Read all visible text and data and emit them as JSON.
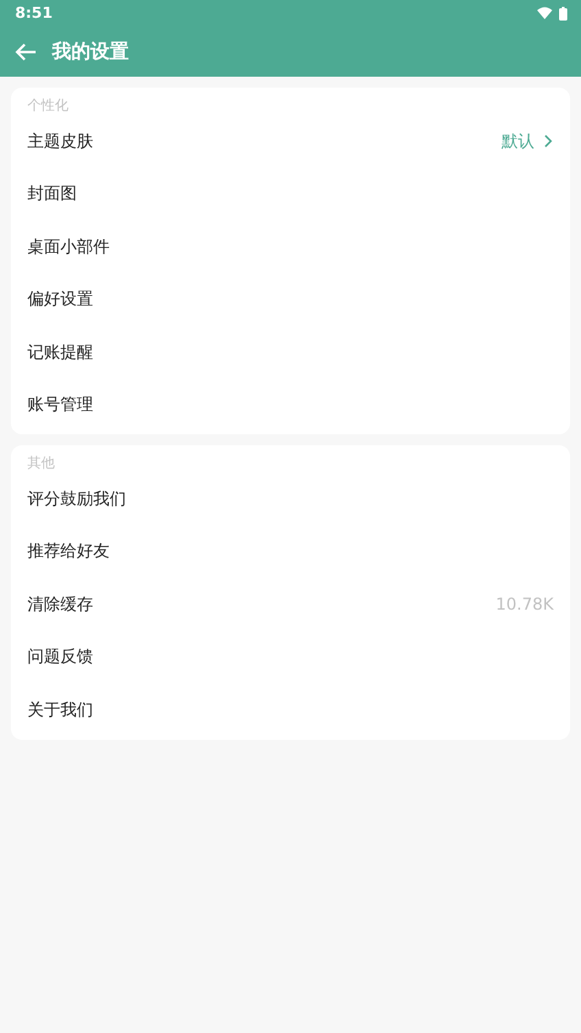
{
  "status_bar": {
    "time": "8:51"
  },
  "app_bar": {
    "title": "我的设置"
  },
  "sections": [
    {
      "header": "个性化",
      "items": [
        {
          "label": "主题皮肤",
          "kind": "link",
          "value": "默认"
        },
        {
          "label": "封面图",
          "kind": "plain"
        },
        {
          "label": "桌面小部件",
          "kind": "plain"
        },
        {
          "label": "偏好设置",
          "kind": "plain"
        },
        {
          "label": "记账提醒",
          "kind": "plain"
        },
        {
          "label": "账号管理",
          "kind": "plain"
        }
      ]
    },
    {
      "header": "其他",
      "items": [
        {
          "label": "评分鼓励我们",
          "kind": "plain"
        },
        {
          "label": "推荐给好友",
          "kind": "plain"
        },
        {
          "label": "清除缓存",
          "kind": "info",
          "value": "10.78K"
        },
        {
          "label": "问题反馈",
          "kind": "plain"
        },
        {
          "label": "关于我们",
          "kind": "plain"
        }
      ]
    }
  ]
}
